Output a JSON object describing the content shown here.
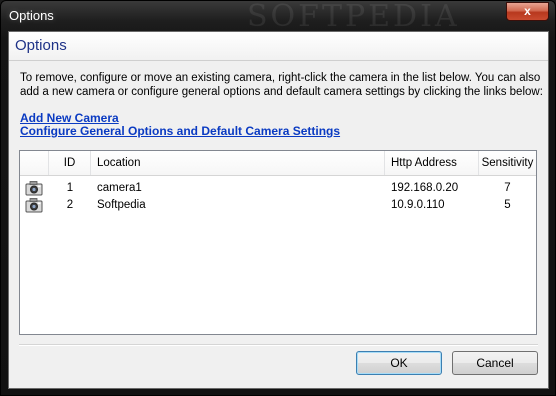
{
  "window": {
    "title": "Options",
    "close_glyph": "x",
    "watermark": "SOFTPEDIA"
  },
  "header": {
    "title": "Options"
  },
  "instructions": "To remove, configure or move an existing camera, right-click the camera in the list below. You can also add a new camera or configure general options and default camera settings by clicking the links below:",
  "links": {
    "add_camera": "Add New Camera",
    "configure": "Configure General Options and Default Camera Settings"
  },
  "table": {
    "columns": [
      "",
      "ID",
      "Location",
      "Http Address",
      "Sensitivity"
    ],
    "rows": [
      {
        "icon": "camera-icon",
        "id": "1",
        "location": "camera1",
        "http": "192.168.0.20",
        "sensitivity": "7"
      },
      {
        "icon": "camera-icon",
        "id": "2",
        "location": "Softpedia",
        "http": "10.9.0.110",
        "sensitivity": "5"
      }
    ]
  },
  "buttons": {
    "ok": "OK",
    "cancel": "Cancel"
  },
  "colors": {
    "header_title": "#1e3287",
    "link": "#0a3ac2",
    "close_button": "#c94b2f"
  }
}
